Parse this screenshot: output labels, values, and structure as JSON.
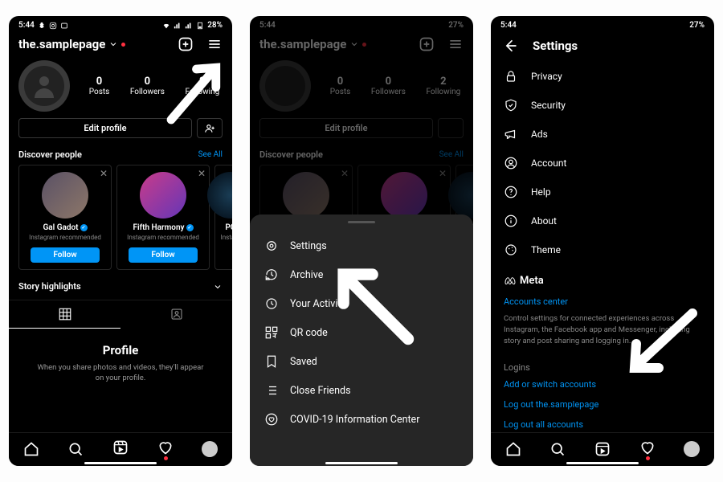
{
  "status": {
    "time": "5:44",
    "battery": "28%",
    "battery2": "27%"
  },
  "profile": {
    "username": "the.samplepage",
    "stats": {
      "posts": "0",
      "posts_label": "Posts",
      "followers": "0",
      "followers_label": "Followers",
      "following": "2",
      "following_label": "Following"
    },
    "edit_label": "Edit profile",
    "discover_label": "Discover people",
    "see_all": "See All",
    "suggestions": [
      {
        "name": "Gal Gadot",
        "note": "Instagram recommended",
        "follow": "Follow"
      },
      {
        "name": "Fifth Harmony",
        "note": "Instagram recommended",
        "follow": "Follow"
      },
      {
        "name": "PO",
        "note": "Instagr"
      }
    ],
    "story_label": "Story highlights",
    "empty_title": "Profile",
    "empty_desc": "When you share photos and videos, they'll appear on your profile."
  },
  "sheet": {
    "items": [
      "Settings",
      "Archive",
      "Your Activity",
      "QR code",
      "Saved",
      "Close Friends",
      "COVID-19 Information Center"
    ]
  },
  "settings": {
    "title": "Settings",
    "rows": [
      "Privacy",
      "Security",
      "Ads",
      "Account",
      "Help",
      "About",
      "Theme"
    ],
    "meta_brand": "Meta",
    "accounts_center": "Accounts center",
    "accounts_desc": "Control settings for connected experiences across Instagram, the Facebook app and Messenger, including story and post sharing and logging in.",
    "logins_label": "Logins",
    "add_switch": "Add or switch accounts",
    "logout_user": "Log out the.samplepage",
    "logout_all": "Log out all accounts"
  }
}
